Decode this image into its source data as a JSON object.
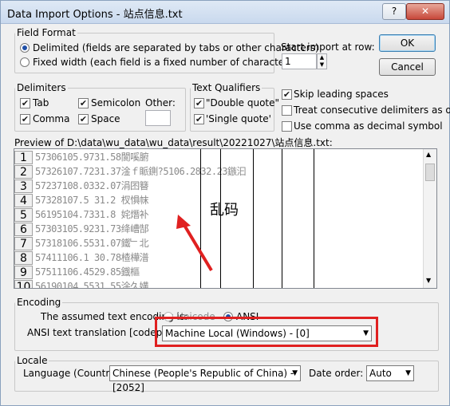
{
  "window": {
    "title": "Data Import Options - 站点信息.txt",
    "help_label": "?",
    "close_label": "✕"
  },
  "field_format": {
    "legend": "Field Format",
    "delimited_label": "Delimited (fields are separated by tabs or other characters)",
    "fixed_label": "Fixed width (each field is a fixed number of characters wide)",
    "selected": "delimited"
  },
  "start_import": {
    "label": "Start import at row:",
    "value": "1"
  },
  "buttons": {
    "ok": "OK",
    "cancel": "Cancel"
  },
  "delimiters": {
    "legend": "Delimiters",
    "tab": "Tab",
    "semicolon": "Semicolon",
    "other": "Other:",
    "comma": "Comma",
    "space": "Space"
  },
  "text_qualifiers": {
    "legend": "Text Qualifiers",
    "double": "\"Double quote\"",
    "single": "'Single quote'"
  },
  "options": {
    "skip_leading": "Skip leading spaces",
    "consecutive": "Treat consecutive delimiters as one",
    "comma_decimal": "Use comma as decimal symbol"
  },
  "preview": {
    "label": "Preview of D:\\data\\wu_data\\wu_data\\result\\20221027\\站点信息.txt:",
    "rows": [
      {
        "num": "1",
        "text": "57306105.9731.58閬嗘腑"
      },
      {
        "num": "2",
        "text": "57326107.7231.37淦ｆ眽鍘?5106.2832.23鏃汩"
      },
      {
        "num": "3",
        "text": "57237108.0332.07涓囨簮"
      },
      {
        "num": "4",
        "text": "57328107.5 31.2 杈惧帓"
      },
      {
        "num": "5",
        "text": "56195104.7331.8 姹熸补"
      },
      {
        "num": "6",
        "text": "57303105.9231.73绛嶆郜"
      },
      {
        "num": "7",
        "text": "57318106.5531.07鐵﹂北"
      },
      {
        "num": "8",
        "text": "57411106.1 30.78楂樺潽"
      },
      {
        "num": "9",
        "text": "57511106.4529.85鐡樞"
      },
      {
        "num": "10",
        "text": "56190104.5531.55涂久媾"
      }
    ]
  },
  "annotation": {
    "text": "乱码",
    "color": "#e02020"
  },
  "encoding": {
    "legend": "Encoding",
    "assumed_label": "The assumed text encoding is:",
    "unicode": "Unicode",
    "ansi": "ANSI",
    "selected": "ANSI",
    "translation_label": "ANSI text translation [codepage]:",
    "translation_value": "Machine Local (Windows) - [0]"
  },
  "locale": {
    "legend": "Locale",
    "language_label": "Language (Country):",
    "language_value": "Chinese (People's Republic of China) - [2052]",
    "date_label": "Date order:",
    "date_value": "Auto"
  }
}
